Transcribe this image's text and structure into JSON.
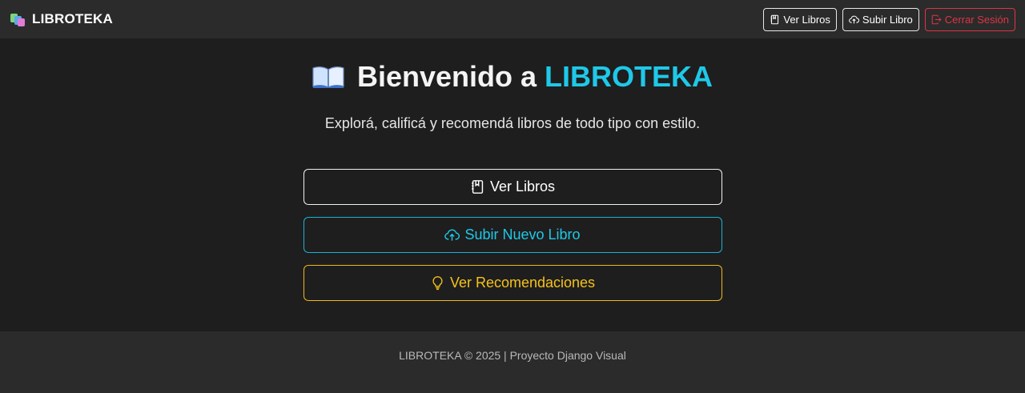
{
  "navbar": {
    "brand": "LIBROTEKA",
    "buttons": {
      "ver_libros": "Ver Libros",
      "subir_libro": "Subir Libro",
      "cerrar_sesion": "Cerrar Sesión"
    }
  },
  "main": {
    "title_prefix": "Bienvenido a ",
    "title_accent": "LIBROTEKA",
    "subtitle": "Explorá, calificá y recomendá libros de todo tipo con estilo.",
    "buttons": {
      "ver_libros": "Ver Libros",
      "subir_nuevo": "Subir Nuevo Libro",
      "recomendaciones": "Ver Recomendaciones"
    }
  },
  "footer": {
    "text": "LIBROTEKA © 2025 | Proyecto Django Visual"
  },
  "colors": {
    "background": "#1e1e1e",
    "bar": "#2b2b2b",
    "accent_cyan": "#1fc8e8",
    "danger": "#dc3545",
    "warning": "#f5c21b"
  },
  "icons": {
    "brand": "books-logo-icon",
    "ver_libros": "journal-bookmark-icon",
    "subir": "cloud-upload-icon",
    "cerrar": "box-arrow-right-icon",
    "title": "open-book-icon",
    "recomendaciones": "lightbulb-icon"
  }
}
